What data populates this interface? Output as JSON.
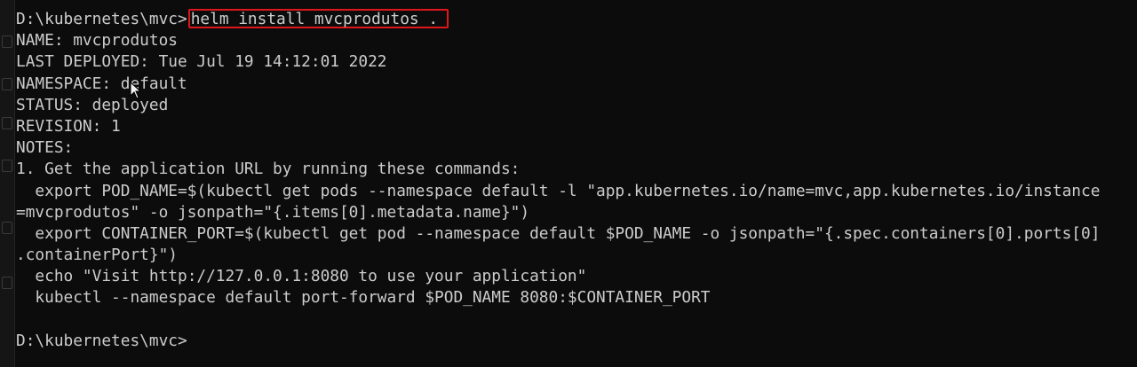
{
  "terminal": {
    "prompt1": "D:\\kubernetes\\mvc>",
    "command": "helm install mvcprodutos .",
    "output": [
      "NAME: mvcprodutos",
      "LAST DEPLOYED: Tue Jul 19 14:12:01 2022",
      "NAMESPACE: default",
      "STATUS: deployed",
      "REVISION: 1",
      "NOTES:",
      "1. Get the application URL by running these commands:",
      "  export POD_NAME=$(kubectl get pods --namespace default -l \"app.kubernetes.io/name=mvc,app.kubernetes.io/instance",
      "=mvcprodutos\" -o jsonpath=\"{.items[0].metadata.name}\")",
      "  export CONTAINER_PORT=$(kubectl get pod --namespace default $POD_NAME -o jsonpath=\"{.spec.containers[0].ports[0]",
      ".containerPort}\")",
      "  echo \"Visit http://127.0.0.1:8080 to use your application\"",
      "  kubectl --namespace default port-forward $POD_NAME 8080:$CONTAINER_PORT",
      ""
    ],
    "prompt2": "D:\\kubernetes\\mvc>"
  },
  "colors": {
    "background": "#0c0c0c",
    "text": "#cccccc",
    "highlight_border": "#e0161a"
  }
}
